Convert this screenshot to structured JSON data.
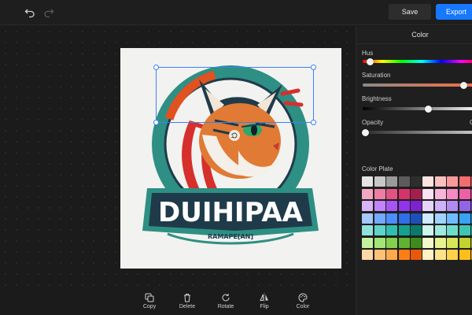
{
  "topbar": {
    "save_label": "Save",
    "export_label": "Export"
  },
  "artboard": {
    "logo_text": "DUIHIPAA",
    "logo_subtext": "RAMAPE[AN]"
  },
  "panel": {
    "title": "Color",
    "hue_label": "Hus",
    "saturation_label": "Saturation",
    "brightness_label": "Brightness",
    "opacity_label": "Opacity",
    "opacity_value": "C",
    "plate_label": "Color Plate",
    "hue_level": 0.06,
    "saturation_level": 0.85,
    "brightness_level": 0.55,
    "opacity_level": 0.02
  },
  "toolbar": {
    "copy_label": "Copy",
    "delete_label": "Delete",
    "rotate_label": "Rotate",
    "flip_label": "Flip",
    "color_label": "Color"
  },
  "palette": {
    "left": [
      [
        "#e4e4e4",
        "#c8c8c8",
        "#9a9a9a",
        "#5c5c5c",
        "#2e2e2e"
      ],
      [
        "#f2a7c0",
        "#ec7fa3",
        "#e25384",
        "#d6336c",
        "#a61e4d"
      ],
      [
        "#d8b4f8",
        "#c084fc",
        "#a855f7",
        "#9333ea",
        "#7e22ce"
      ],
      [
        "#a5c8ff",
        "#74a9ff",
        "#4d8dff",
        "#2f6fe8",
        "#1d4fb8"
      ],
      [
        "#8fe3dc",
        "#5fd4c8",
        "#2fbfae",
        "#14a190",
        "#0b7a6c"
      ],
      [
        "#c6f2a0",
        "#a3e676",
        "#82d14e",
        "#5fb330",
        "#3f8a1c"
      ],
      [
        "#ffd8a8",
        "#ffc078",
        "#ffa94d",
        "#fd7e14",
        "#e8590c"
      ]
    ],
    "right": [
      [
        "#fde2e2",
        "#fbbfbf",
        "#f79a9a",
        "#f26d6d",
        "#e64545"
      ],
      [
        "#fce1f0",
        "#f8b4d9",
        "#f48bc3",
        "#ee5fa8",
        "#d9408a"
      ],
      [
        "#e6d4fb",
        "#cfb1f7",
        "#b18bf0",
        "#9265e6",
        "#7244cf"
      ],
      [
        "#cfe9ff",
        "#9fd3ff",
        "#6ebcff",
        "#3aa2f5",
        "#1784d9"
      ],
      [
        "#cdf5ee",
        "#9eebdd",
        "#6edccb",
        "#3fc6b3",
        "#1fa592"
      ],
      [
        "#f3f9c9",
        "#e8f28f",
        "#d8e65a",
        "#c3d22f",
        "#a3b41a"
      ],
      [
        "#fff3c4",
        "#ffe38a",
        "#ffd24d",
        "#ffbe1a",
        "#f0a500"
      ]
    ]
  },
  "icons": {
    "undo": "undo-arrow-icon",
    "redo": "redo-arrow-icon",
    "copy": "copy-icon",
    "delete": "trash-icon",
    "rotate": "rotate-icon",
    "flip": "flip-icon",
    "color": "palette-icon"
  },
  "colors": {
    "accent": "#1677ff",
    "selection": "#3b82f6"
  }
}
